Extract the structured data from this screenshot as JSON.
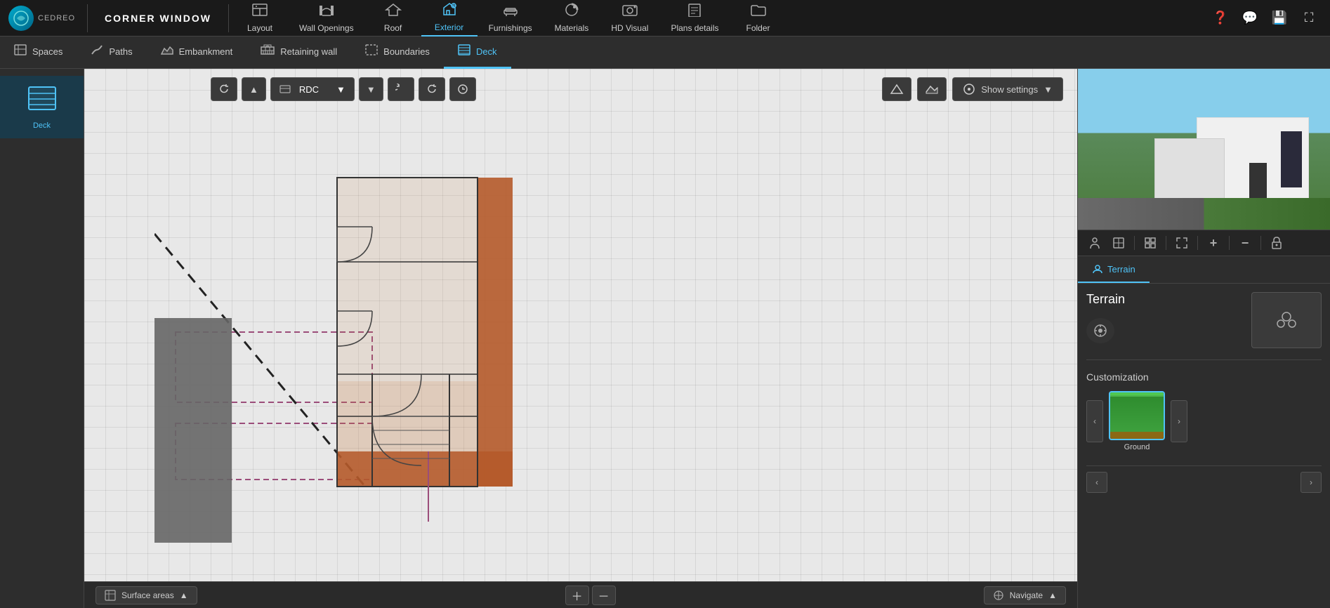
{
  "app": {
    "logo_text": "CEDREO",
    "title": "CORNER WINDOW"
  },
  "toolbar": {
    "items": [
      {
        "id": "layout",
        "label": "Layout",
        "icon": "✏️"
      },
      {
        "id": "wall-openings",
        "label": "Wall Openings",
        "icon": "🪟"
      },
      {
        "id": "roof",
        "label": "Roof",
        "icon": "🏠"
      },
      {
        "id": "exterior",
        "label": "Exterior",
        "icon": "🏡",
        "active": true
      },
      {
        "id": "furnishings",
        "label": "Furnishings",
        "icon": "🛋️"
      },
      {
        "id": "materials",
        "label": "Materials",
        "icon": "🎨"
      },
      {
        "id": "hd-visual",
        "label": "HD Visual",
        "icon": "📷"
      },
      {
        "id": "plans-details",
        "label": "Plans details",
        "icon": "📋"
      },
      {
        "id": "folder",
        "label": "Folder",
        "icon": "📁"
      }
    ],
    "right_btns": [
      {
        "id": "help",
        "icon": "❓"
      },
      {
        "id": "chat",
        "icon": "💬"
      },
      {
        "id": "save",
        "icon": "💾"
      },
      {
        "id": "fullscreen",
        "icon": "⛶"
      }
    ]
  },
  "sub_toolbar": {
    "items": [
      {
        "id": "spaces",
        "label": "Spaces",
        "icon": "⬜"
      },
      {
        "id": "paths",
        "label": "Paths",
        "icon": "〰️"
      },
      {
        "id": "embankment",
        "label": "Embankment",
        "icon": "⛰️"
      },
      {
        "id": "retaining-wall",
        "label": "Retaining wall",
        "icon": "🧱"
      },
      {
        "id": "boundaries",
        "label": "Boundaries",
        "icon": "⬚"
      },
      {
        "id": "deck",
        "label": "Deck",
        "icon": "▦",
        "active": true
      }
    ]
  },
  "left_panel": {
    "tools": [
      {
        "id": "deck",
        "label": "Deck",
        "icon": "▦",
        "active": true
      }
    ]
  },
  "canvas": {
    "floor": "RDC",
    "show_settings_label": "Show settings"
  },
  "bottom_bar": {
    "surface_areas_label": "Surface areas",
    "navigate_label": "Navigate"
  },
  "right_panel": {
    "terrain_tab_label": "Terrain",
    "terrain_title": "Terrain",
    "customization_title": "Customization",
    "ground_label": "Ground",
    "view_controls": [
      {
        "id": "person",
        "icon": "👤"
      },
      {
        "id": "view2",
        "icon": "🔲"
      },
      {
        "id": "filter",
        "icon": "⊞"
      },
      {
        "id": "move",
        "icon": "⤢"
      },
      {
        "id": "zoom-in",
        "icon": "+"
      },
      {
        "id": "zoom-out",
        "icon": "−"
      },
      {
        "id": "lock",
        "icon": "🔒"
      }
    ]
  }
}
